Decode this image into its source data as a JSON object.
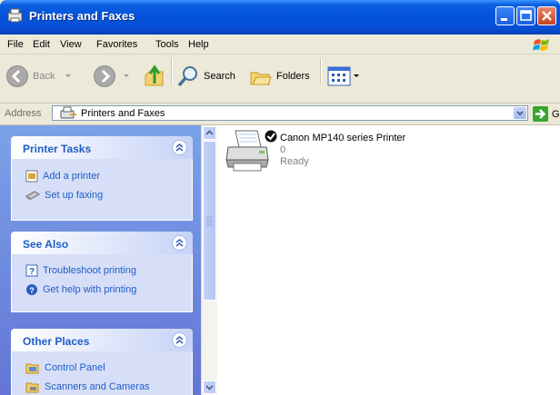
{
  "window": {
    "title": "Printers and Faxes"
  },
  "menu": [
    "File",
    "Edit",
    "View",
    "Favorites",
    "Tools",
    "Help"
  ],
  "toolbar": {
    "back_label": "Back",
    "search_label": "Search",
    "folders_label": "Folders"
  },
  "address": {
    "label": "Address",
    "value": "Printers and Faxes",
    "go_label": "Go"
  },
  "taskpane": {
    "printer_tasks": {
      "title": "Printer Tasks",
      "links": [
        "Add a printer",
        "Set up faxing"
      ]
    },
    "see_also": {
      "title": "See Also",
      "links": [
        "Troubleshoot printing",
        "Get help with printing"
      ]
    },
    "other_places": {
      "title": "Other Places",
      "links": [
        "Control Panel",
        "Scanners and Cameras"
      ]
    }
  },
  "printer": {
    "name": "Canon MP140 series Printer",
    "documents": "0",
    "status": "Ready"
  },
  "colors": {
    "title_bar": "#0453da",
    "task_link": "#215dc6",
    "task_pane": "#7ba2e7"
  }
}
